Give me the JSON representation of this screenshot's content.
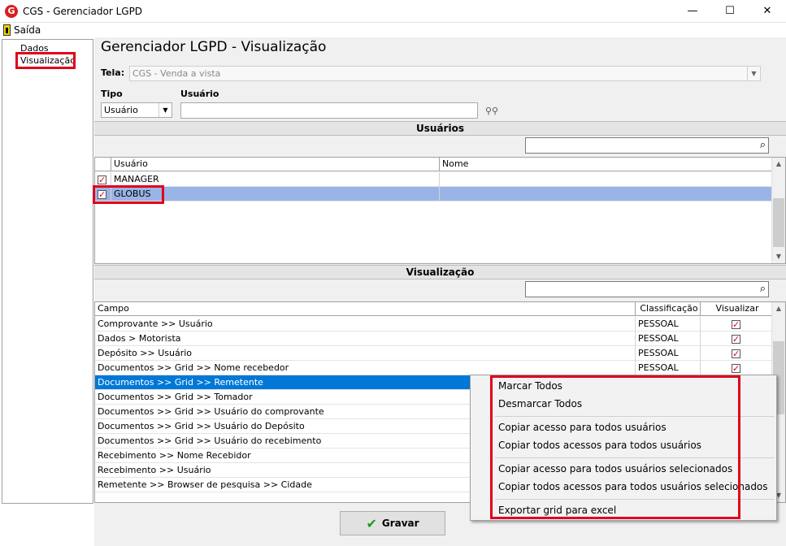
{
  "window": {
    "title": "CGS - Gerenciador LGPD",
    "app_icon": "G",
    "minimize": "—",
    "maximize": "☐",
    "close": "✕"
  },
  "menubar": {
    "exit_label": "Saída"
  },
  "tree": {
    "items": [
      "Dados",
      "Visualização"
    ]
  },
  "main": {
    "heading": "Gerenciador LGPD - Visualização",
    "tela_label": "Tela:",
    "tela_value": "CGS - Venda a vista",
    "tipo_label": "Tipo",
    "tipo_value": "Usuário",
    "usuario_label": "Usuário",
    "usuario_value": ""
  },
  "usuarios": {
    "band_title": "Usuários",
    "search_value": "",
    "columns": [
      "Usuário",
      "Nome"
    ],
    "rows": [
      {
        "checked": true,
        "usuario": "MANAGER",
        "nome": ""
      },
      {
        "checked": true,
        "usuario": "GLOBUS",
        "nome": ""
      }
    ]
  },
  "visualizacao": {
    "band_title": "Visualização",
    "search_value": "",
    "columns": [
      "Campo",
      "Classificação",
      "Visualizar"
    ],
    "rows": [
      {
        "campo": "Comprovante >> Usuário",
        "classificacao": "PESSOAL",
        "visualizar": true
      },
      {
        "campo": "Dados > Motorista",
        "classificacao": "PESSOAL",
        "visualizar": true
      },
      {
        "campo": "Depósito >> Usuário",
        "classificacao": "PESSOAL",
        "visualizar": true
      },
      {
        "campo": "Documentos >> Grid >> Nome recebedor",
        "classificacao": "PESSOAL",
        "visualizar": true
      },
      {
        "campo": "Documentos >> Grid >> Remetente",
        "classificacao": "",
        "visualizar": null
      },
      {
        "campo": "Documentos >> Grid >> Tomador",
        "classificacao": "",
        "visualizar": null
      },
      {
        "campo": "Documentos >> Grid >> Usuário do comprovante",
        "classificacao": "",
        "visualizar": null
      },
      {
        "campo": "Documentos >> Grid >> Usuário do Depósito",
        "classificacao": "",
        "visualizar": null
      },
      {
        "campo": "Documentos >> Grid >> Usuário do recebimento",
        "classificacao": "",
        "visualizar": null
      },
      {
        "campo": "Recebimento >> Nome Recebidor",
        "classificacao": "",
        "visualizar": null
      },
      {
        "campo": "Recebimento >> Usuário",
        "classificacao": "",
        "visualizar": null
      },
      {
        "campo": "Remetente >> Browser de pesquisa >> Cidade",
        "classificacao": "",
        "visualizar": null
      }
    ]
  },
  "context_menu": {
    "items": [
      "Marcar Todos",
      "Desmarcar Todos",
      "Copiar acesso para todos usuários",
      "Copiar todos acessos para todos usuários",
      "Copiar acesso para todos usuários selecionados",
      "Copiar todos acessos para todos usuários selecionados",
      "Exportar grid para excel"
    ]
  },
  "footer": {
    "save_label": "Gravar",
    "save_icon": "check-icon"
  },
  "colors": {
    "highlight": "#0078d7",
    "selected_row": "#99b4e6",
    "annotation": "#e2001a"
  }
}
